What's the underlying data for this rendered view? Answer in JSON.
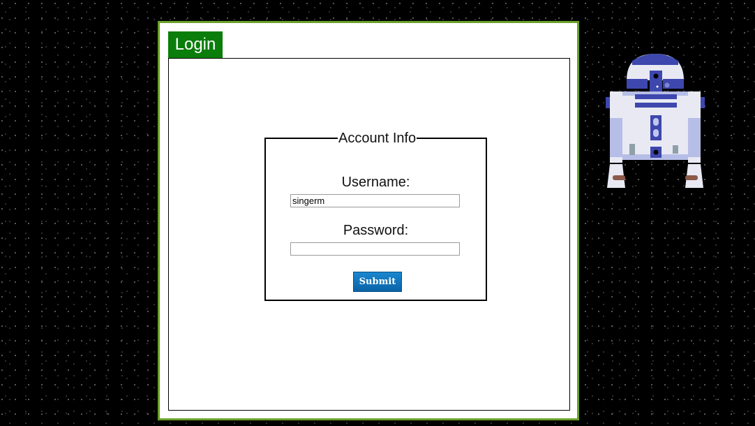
{
  "login_tab": {
    "label": "Login"
  },
  "form": {
    "legend": "Account Info",
    "username_label": "Username:",
    "username_value": "singerm",
    "password_label": "Password:",
    "password_value": "",
    "submit_label": "Submit"
  },
  "colors": {
    "panel_border": "#6aa12a",
    "tab_background": "#0b7d0b",
    "submit_button": "#0a70ba"
  },
  "icons": {
    "robot": "r2d2-icon"
  }
}
